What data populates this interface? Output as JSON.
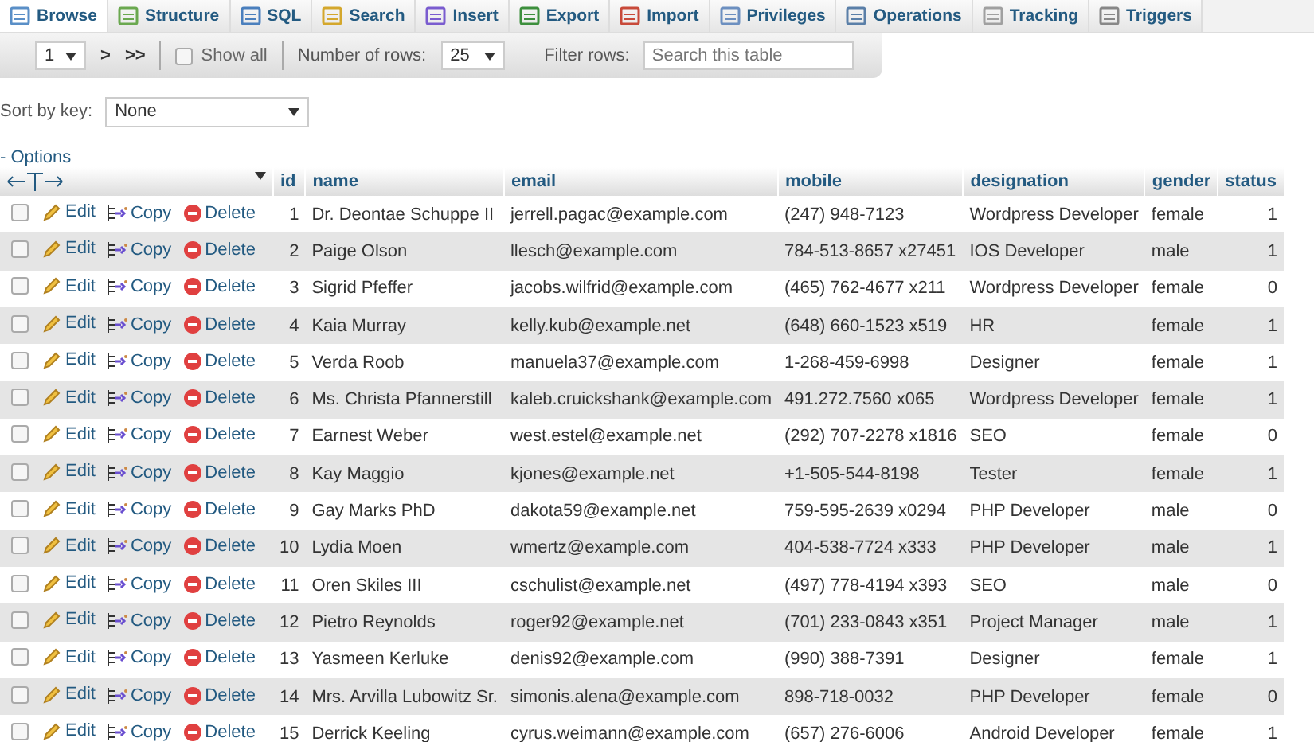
{
  "tabs": [
    {
      "label": "Browse",
      "selected": true
    },
    {
      "label": "Structure",
      "selected": false
    },
    {
      "label": "SQL",
      "selected": false
    },
    {
      "label": "Search",
      "selected": false
    },
    {
      "label": "Insert",
      "selected": false
    },
    {
      "label": "Export",
      "selected": false
    },
    {
      "label": "Import",
      "selected": false
    },
    {
      "label": "Privileges",
      "selected": false
    },
    {
      "label": "Operations",
      "selected": false
    },
    {
      "label": "Tracking",
      "selected": false
    },
    {
      "label": "Triggers",
      "selected": false
    }
  ],
  "navigation": {
    "page": "1",
    "next": ">",
    "last": ">>",
    "show_all": {
      "label": "Show all",
      "checked": false
    },
    "rows_label": "Number of rows:",
    "rows_value": "25",
    "filter_label": "Filter rows:",
    "filter_placeholder": "Search this table"
  },
  "sort": {
    "label": "Sort by key:",
    "value": "None"
  },
  "options_link": "- Options",
  "table": {
    "columns": [
      "id",
      "name",
      "email",
      "mobile",
      "designation",
      "gender",
      "status"
    ],
    "rows": [
      {
        "selected": false,
        "actions": [
          "Edit",
          "Copy",
          "Delete"
        ],
        "cells": [
          "1",
          "Dr. Deontae Schuppe II",
          "jerrell.pagac@example.com",
          "(247) 948-7123",
          "Wordpress Developer",
          "female",
          "1"
        ]
      },
      {
        "selected": false,
        "actions": [
          "Edit",
          "Copy",
          "Delete"
        ],
        "cells": [
          "2",
          "Paige Olson",
          "llesch@example.com",
          "784-513-8657 x27451",
          "IOS Developer",
          "male",
          "1"
        ]
      },
      {
        "selected": false,
        "actions": [
          "Edit",
          "Copy",
          "Delete"
        ],
        "cells": [
          "3",
          "Sigrid Pfeffer",
          "jacobs.wilfrid@example.com",
          "(465) 762-4677 x211",
          "Wordpress Developer",
          "female",
          "0"
        ]
      },
      {
        "selected": false,
        "actions": [
          "Edit",
          "Copy",
          "Delete"
        ],
        "cells": [
          "4",
          "Kaia Murray",
          "kelly.kub@example.net",
          "(648) 660-1523 x519",
          "HR",
          "female",
          "1"
        ]
      },
      {
        "selected": false,
        "actions": [
          "Edit",
          "Copy",
          "Delete"
        ],
        "cells": [
          "5",
          "Verda Roob",
          "manuela37@example.com",
          "1-268-459-6998",
          "Designer",
          "female",
          "1"
        ]
      },
      {
        "selected": false,
        "actions": [
          "Edit",
          "Copy",
          "Delete"
        ],
        "cells": [
          "6",
          "Ms. Christa Pfannerstill",
          "kaleb.cruickshank@example.com",
          "491.272.7560 x065",
          "Wordpress Developer",
          "female",
          "1"
        ]
      },
      {
        "selected": false,
        "actions": [
          "Edit",
          "Copy",
          "Delete"
        ],
        "cells": [
          "7",
          "Earnest Weber",
          "west.estel@example.net",
          "(292) 707-2278 x1816",
          "SEO",
          "female",
          "0"
        ]
      },
      {
        "selected": false,
        "actions": [
          "Edit",
          "Copy",
          "Delete"
        ],
        "cells": [
          "8",
          "Kay Maggio",
          "kjones@example.net",
          "+1-505-544-8198",
          "Tester",
          "female",
          "1"
        ]
      },
      {
        "selected": false,
        "actions": [
          "Edit",
          "Copy",
          "Delete"
        ],
        "cells": [
          "9",
          "Gay Marks PhD",
          "dakota59@example.net",
          "759-595-2639 x0294",
          "PHP Developer",
          "male",
          "0"
        ]
      },
      {
        "selected": false,
        "actions": [
          "Edit",
          "Copy",
          "Delete"
        ],
        "cells": [
          "10",
          "Lydia Moen",
          "wmertz@example.com",
          "404-538-7724 x333",
          "PHP Developer",
          "male",
          "1"
        ]
      },
      {
        "selected": false,
        "actions": [
          "Edit",
          "Copy",
          "Delete"
        ],
        "cells": [
          "11",
          "Oren Skiles III",
          "cschulist@example.net",
          "(497) 778-4194 x393",
          "SEO",
          "male",
          "0"
        ]
      },
      {
        "selected": false,
        "actions": [
          "Edit",
          "Copy",
          "Delete"
        ],
        "cells": [
          "12",
          "Pietro Reynolds",
          "roger92@example.net",
          "(701) 233-0843 x351",
          "Project Manager",
          "male",
          "1"
        ]
      },
      {
        "selected": false,
        "actions": [
          "Edit",
          "Copy",
          "Delete"
        ],
        "cells": [
          "13",
          "Yasmeen Kerluke",
          "denis92@example.com",
          "(990) 388-7391",
          "Designer",
          "female",
          "1"
        ]
      },
      {
        "selected": false,
        "actions": [
          "Edit",
          "Copy",
          "Delete"
        ],
        "cells": [
          "14",
          "Mrs. Arvilla Lubowitz Sr.",
          "simonis.alena@example.com",
          "898-718-0032",
          "PHP Developer",
          "female",
          "0"
        ]
      },
      {
        "selected": false,
        "actions": [
          "Edit",
          "Copy",
          "Delete"
        ],
        "cells": [
          "15",
          "Derrick Keeling",
          "cyrus.weimann@example.com",
          "(657) 276-6006",
          "Android Developer",
          "female",
          "1"
        ]
      }
    ]
  }
}
